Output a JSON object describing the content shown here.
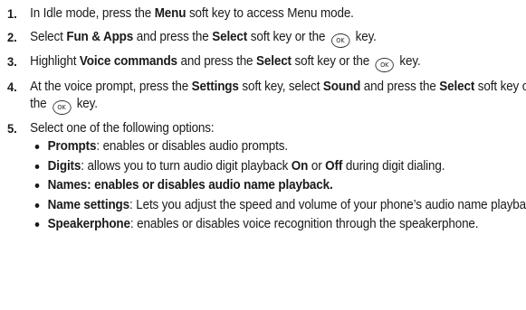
{
  "ok_key_label": "OK",
  "steps": [
    {
      "num": "1.",
      "parts": [
        {
          "t": "In Idle mode, press the "
        },
        {
          "t": "Menu",
          "b": true
        },
        {
          "t": " soft key to access Menu mode."
        }
      ]
    },
    {
      "num": "2.",
      "parts": [
        {
          "t": "Select "
        },
        {
          "t": "Fun & Apps",
          "b": true
        },
        {
          "t": " and press the "
        },
        {
          "t": "Select",
          "b": true
        },
        {
          "t": " soft key or the "
        },
        {
          "ok": true
        },
        {
          "t": " key."
        }
      ]
    },
    {
      "num": "3.",
      "parts": [
        {
          "t": "Highlight "
        },
        {
          "t": "Voice commands",
          "b": true
        },
        {
          "t": " and press the "
        },
        {
          "t": "Select",
          "b": true
        },
        {
          "t": " soft key or the "
        },
        {
          "ok": true
        },
        {
          "t": " key."
        }
      ]
    },
    {
      "num": "4.",
      "parts": [
        {
          "t": "At the voice prompt, press the "
        },
        {
          "t": "Settings",
          "b": true
        },
        {
          "t": " soft key, select "
        },
        {
          "t": "Sound",
          "b": true
        },
        {
          "t": " and press the "
        },
        {
          "t": "Select",
          "b": true
        },
        {
          "t": " soft key or the "
        },
        {
          "ok": true
        },
        {
          "t": " key."
        }
      ]
    },
    {
      "num": "5.",
      "parts": [
        {
          "t": "Select one of the following options:"
        }
      ],
      "options": [
        {
          "parts": [
            {
              "t": "Prompts",
              "b": true
            },
            {
              "t": ": enables or disables audio prompts."
            }
          ]
        },
        {
          "parts": [
            {
              "t": "Digits",
              "b": true
            },
            {
              "t": ": allows you to turn audio digit playback "
            },
            {
              "t": "On",
              "b": true
            },
            {
              "t": " or "
            },
            {
              "t": "Off",
              "b": true
            },
            {
              "t": " during digit dialing."
            }
          ]
        },
        {
          "parts": [
            {
              "t": "Names: enables or disables audio name playback.",
              "b": true
            }
          ]
        },
        {
          "parts": [
            {
              "t": "Name settings",
              "b": true
            },
            {
              "t": ": Lets you adjust the speed and volume of your phone’s audio name playback."
            }
          ]
        },
        {
          "parts": [
            {
              "t": "Speakerphone",
              "b": true
            },
            {
              "t": ": enables or disables voice recognition through the speakerphone."
            }
          ]
        }
      ]
    }
  ]
}
